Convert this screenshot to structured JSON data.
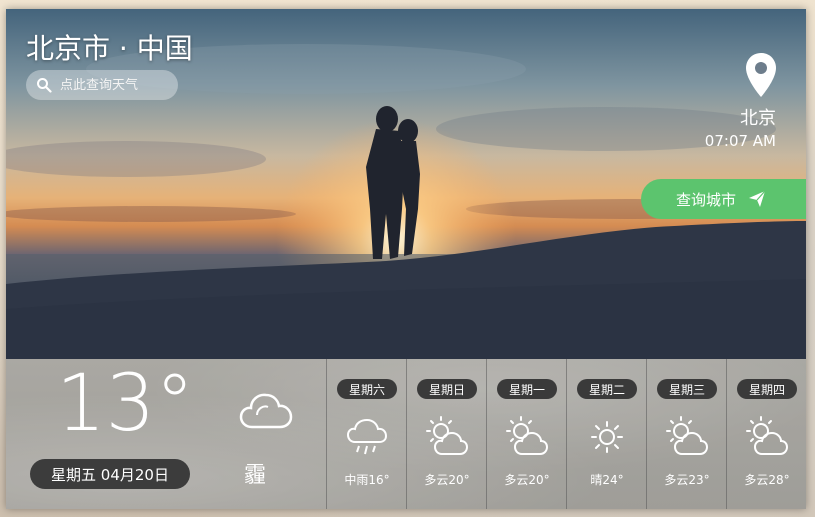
{
  "header": {
    "city_title": "北京市 · 中国",
    "search_placeholder": "点此查询天气"
  },
  "location": {
    "name": "北京",
    "time": "07:07 AM",
    "query_button_label": "查询城市"
  },
  "current": {
    "temperature": "13°",
    "date": "星期五 04月20日",
    "condition": "霾",
    "icon": "haze-cloud-icon"
  },
  "forecast": [
    {
      "day": "星期六",
      "text": "中雨16°",
      "icon": "rain-icon"
    },
    {
      "day": "星期日",
      "text": "多云20°",
      "icon": "partly-cloudy-icon"
    },
    {
      "day": "星期一",
      "text": "多云20°",
      "icon": "partly-cloudy-icon"
    },
    {
      "day": "星期二",
      "text": "晴24°",
      "icon": "sunny-icon"
    },
    {
      "day": "星期三",
      "text": "多云23°",
      "icon": "partly-cloudy-icon"
    },
    {
      "day": "星期四",
      "text": "多云28°",
      "icon": "partly-cloudy-icon"
    }
  ],
  "colors": {
    "accent_green": "#5cc46e",
    "pill_dark": "#3a3a3a"
  }
}
